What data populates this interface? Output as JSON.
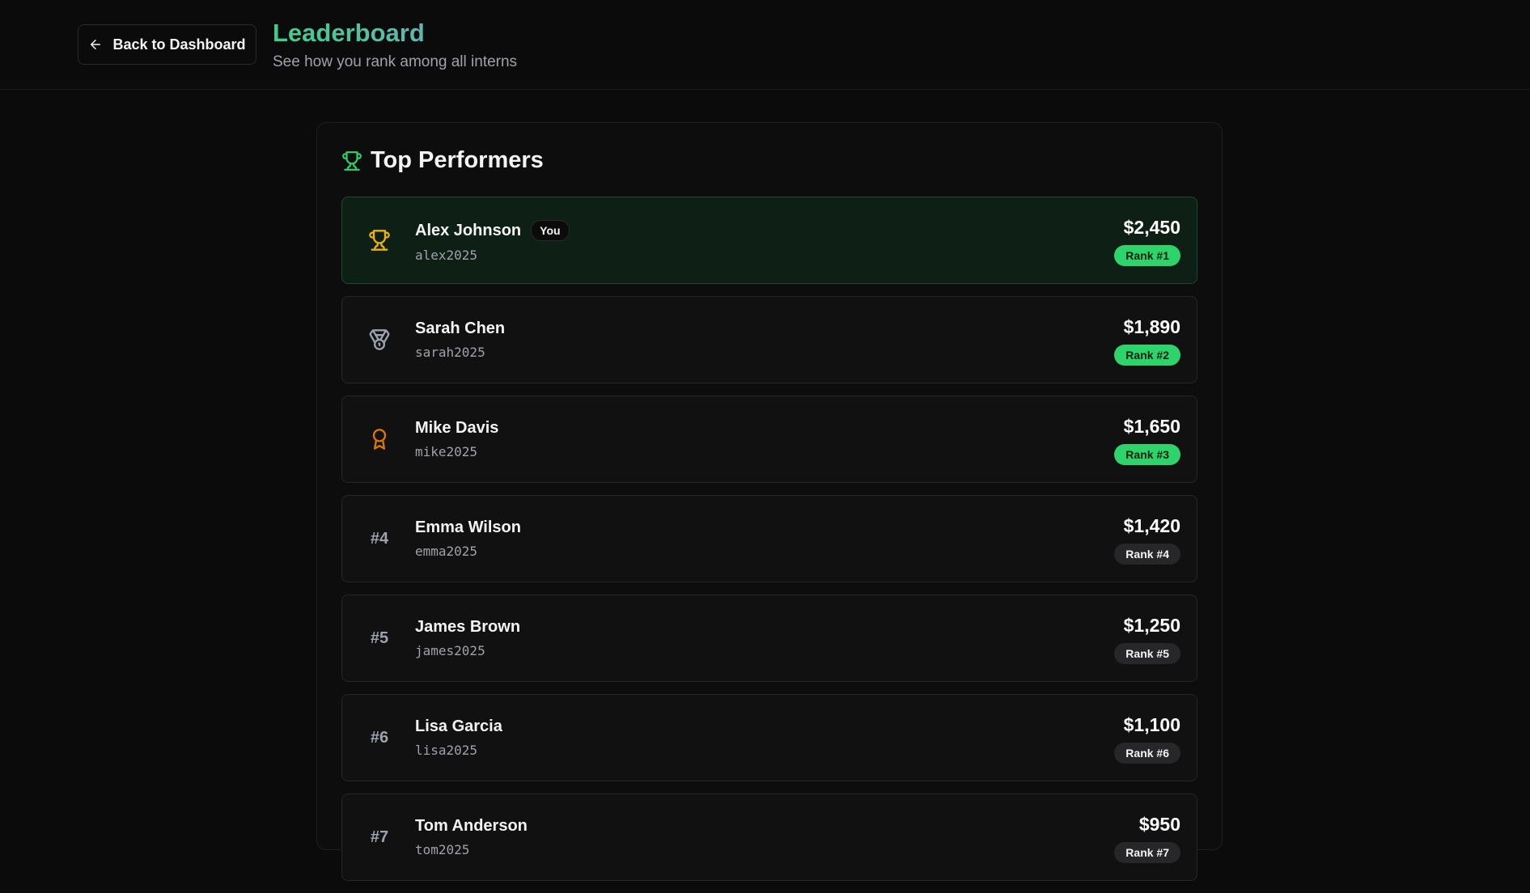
{
  "header": {
    "back_label": "Back to Dashboard",
    "title": "Leaderboard",
    "subtitle": "See how you rank among all interns"
  },
  "card": {
    "title": "Top Performers",
    "title_icon": "trophy-icon"
  },
  "you_label": "You",
  "rows": [
    {
      "name": "Alex Johnson",
      "username": "alex2025",
      "amount": "$2,450",
      "rank_label": "Rank #1",
      "icon": "trophy-icon",
      "is_you": true
    },
    {
      "name": "Sarah Chen",
      "username": "sarah2025",
      "amount": "$1,890",
      "rank_label": "Rank #2",
      "icon": "medal-icon"
    },
    {
      "name": "Mike Davis",
      "username": "mike2025",
      "amount": "$1,650",
      "rank_label": "Rank #3",
      "icon": "award-icon"
    },
    {
      "name": "Emma Wilson",
      "username": "emma2025",
      "amount": "$1,420",
      "rank_label": "Rank #4",
      "rank_text": "#4"
    },
    {
      "name": "James Brown",
      "username": "james2025",
      "amount": "$1,250",
      "rank_label": "Rank #5",
      "rank_text": "#5"
    },
    {
      "name": "Lisa Garcia",
      "username": "lisa2025",
      "amount": "$1,100",
      "rank_label": "Rank #6",
      "rank_text": "#6"
    },
    {
      "name": "Tom Anderson",
      "username": "tom2025",
      "amount": "$950",
      "rank_label": "Rank #7",
      "rank_text": "#7"
    }
  ],
  "colors": {
    "accent_green": "#2fd36b",
    "gold": "#eab308",
    "silver": "#9ca3af",
    "bronze": "#d97706"
  }
}
